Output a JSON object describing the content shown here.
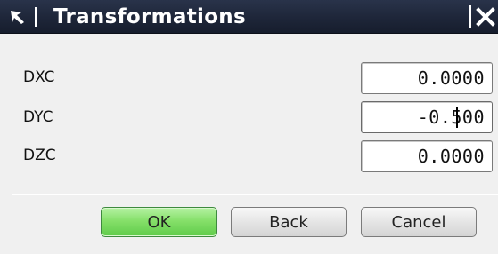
{
  "window": {
    "title": "Transformations",
    "title_icon": "select-arrow-icon",
    "close_icon": "close-icon"
  },
  "fields": [
    {
      "label": "DXC",
      "value": "0.0000"
    },
    {
      "label": "DYC",
      "value": "-0.500"
    },
    {
      "label": "DZC",
      "value": "0.0000"
    }
  ],
  "buttons": {
    "ok": "OK",
    "back": "Back",
    "cancel": "Cancel"
  },
  "colors": {
    "titlebar": "#1e2639",
    "ok_button": "#86e06a",
    "background": "#f0f0f0"
  }
}
